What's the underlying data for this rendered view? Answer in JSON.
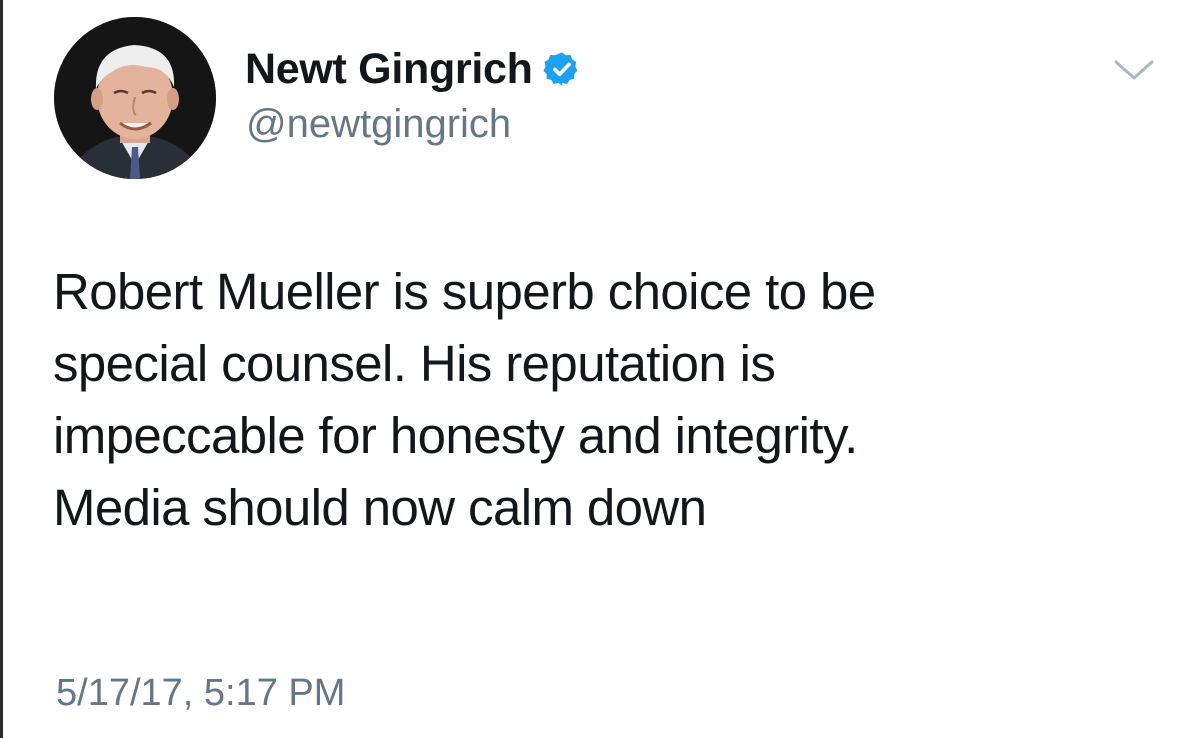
{
  "author": {
    "display_name": "Newt Gingrich",
    "handle": "@newtgingrich",
    "verified": true,
    "avatar_icon": "profile-photo"
  },
  "tweet": {
    "lines": [
      "Robert Mueller is superb choice to be",
      "special counsel. His reputation is",
      "impeccable for honesty and integrity.",
      "Media should now calm down"
    ],
    "timestamp": "5/17/17, 5:17 PM"
  },
  "controls": {
    "menu_icon": "chevron-down-icon"
  },
  "colors": {
    "text": "#14171a",
    "secondary_text": "#657786",
    "verified_blue": "#1da1f2",
    "caret": "#aab8c2"
  }
}
